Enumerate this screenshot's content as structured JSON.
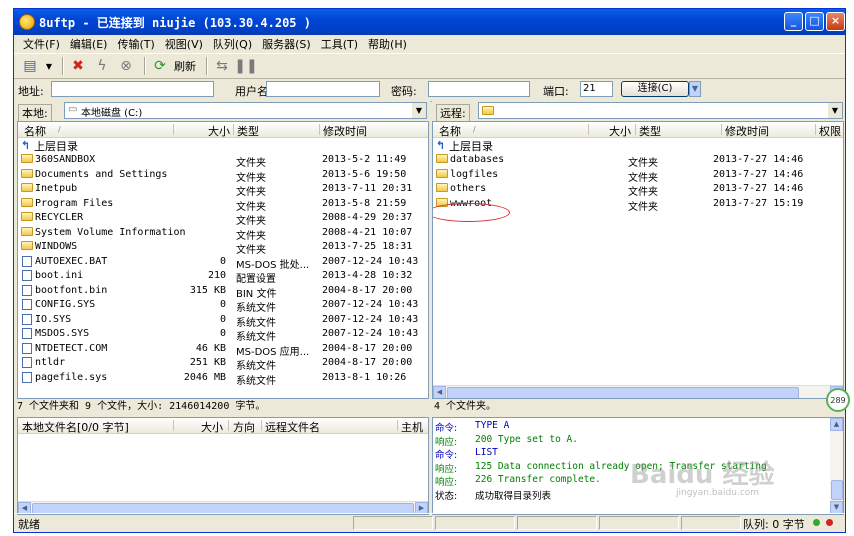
{
  "window": {
    "title": "8uftp - 已连接到 niujie (103.30.4.205  )"
  },
  "menu": [
    "文件(F)",
    "编辑(E)",
    "传输(T)",
    "视图(V)",
    "队列(Q)",
    "服务器(S)",
    "工具(T)",
    "帮助(H)"
  ],
  "toolbar": {
    "refresh_label": "刷新"
  },
  "address": {
    "addr_label": "地址:",
    "user_label": "用户名",
    "pass_label": "密码:",
    "port_label": "端口:",
    "port_value": "21",
    "connect_label": "连接(C)"
  },
  "local": {
    "label": "本地:",
    "path": "本地磁盘 (C:)",
    "columns": {
      "name": "名称",
      "size": "大小",
      "type": "类型",
      "modified": "修改时间"
    },
    "up_label": "上层目录",
    "files": [
      {
        "name": "360SANDBOX",
        "size": "",
        "type": "文件夹",
        "modified": "2013-5-2 11:49",
        "kind": "folder"
      },
      {
        "name": "Documents and Settings",
        "size": "",
        "type": "文件夹",
        "modified": "2013-5-6 19:50",
        "kind": "folder"
      },
      {
        "name": "Inetpub",
        "size": "",
        "type": "文件夹",
        "modified": "2013-7-11 20:31",
        "kind": "folder"
      },
      {
        "name": "Program Files",
        "size": "",
        "type": "文件夹",
        "modified": "2013-5-8 21:59",
        "kind": "folder"
      },
      {
        "name": "RECYCLER",
        "size": "",
        "type": "文件夹",
        "modified": "2008-4-29 20:37",
        "kind": "folder"
      },
      {
        "name": "System Volume Information",
        "size": "",
        "type": "文件夹",
        "modified": "2008-4-21 10:07",
        "kind": "folder"
      },
      {
        "name": "WINDOWS",
        "size": "",
        "type": "文件夹",
        "modified": "2013-7-25 18:31",
        "kind": "folder"
      },
      {
        "name": "AUTOEXEC.BAT",
        "size": "0",
        "type": "MS-DOS 批处...",
        "modified": "2007-12-24 10:43",
        "kind": "file"
      },
      {
        "name": "boot.ini",
        "size": "210",
        "type": "配置设置",
        "modified": "2013-4-28 10:32",
        "kind": "file"
      },
      {
        "name": "bootfont.bin",
        "size": "315 KB",
        "type": "BIN 文件",
        "modified": "2004-8-17 20:00",
        "kind": "file"
      },
      {
        "name": "CONFIG.SYS",
        "size": "0",
        "type": "系统文件",
        "modified": "2007-12-24 10:43",
        "kind": "file"
      },
      {
        "name": "IO.SYS",
        "size": "0",
        "type": "系统文件",
        "modified": "2007-12-24 10:43",
        "kind": "file"
      },
      {
        "name": "MSDOS.SYS",
        "size": "0",
        "type": "系统文件",
        "modified": "2007-12-24 10:43",
        "kind": "file"
      },
      {
        "name": "NTDETECT.COM",
        "size": "46 KB",
        "type": "MS-DOS 应用...",
        "modified": "2004-8-17 20:00",
        "kind": "file"
      },
      {
        "name": "ntldr",
        "size": "251 KB",
        "type": "系统文件",
        "modified": "2004-8-17 20:00",
        "kind": "file"
      },
      {
        "name": "pagefile.sys",
        "size": "2046 MB",
        "type": "系统文件",
        "modified": "2013-8-1 10:26",
        "kind": "file"
      }
    ],
    "status": "7 个文件夹和 9 个文件，大小: 2146014200 字节。"
  },
  "remote": {
    "label": "远程:",
    "columns": {
      "name": "名称",
      "size": "大小",
      "type": "类型",
      "modified": "修改时间",
      "perm": "权限"
    },
    "up_label": "上层目录",
    "files": [
      {
        "name": "databases",
        "type": "文件夹",
        "modified": "2013-7-27 14:46"
      },
      {
        "name": "logfiles",
        "type": "文件夹",
        "modified": "2013-7-27 14:46"
      },
      {
        "name": "others",
        "type": "文件夹",
        "modified": "2013-7-27 14:46"
      },
      {
        "name": "wwwroot",
        "type": "文件夹",
        "modified": "2013-7-27 15:19"
      }
    ],
    "status": "4 个文件夹。"
  },
  "queue": {
    "columns": {
      "local": "本地文件名[0/0 字节]",
      "size": "大小",
      "dir": "方向",
      "remote": "远程文件名",
      "host": "主机"
    }
  },
  "log": [
    {
      "key": "命令:",
      "value": "TYPE A",
      "color": "#0000c0"
    },
    {
      "key": "响应:",
      "value": "200 Type set to A.",
      "color": "#008000"
    },
    {
      "key": "命令:",
      "value": "LIST",
      "color": "#0000c0"
    },
    {
      "key": "响应:",
      "value": "125 Data connection already open; Transfer starting",
      "color": "#008000"
    },
    {
      "key": "响应:",
      "value": "226 Transfer complete.",
      "color": "#008000"
    },
    {
      "key": "状态:",
      "value": "成功取得目录列表",
      "color": "#000000"
    }
  ],
  "statusbar": {
    "ready": "就绪",
    "queue": "队列: 0 字节"
  },
  "watermark": {
    "brand": "Baidu 经验",
    "url": "jingyan.baidu.com"
  },
  "badge": "289"
}
